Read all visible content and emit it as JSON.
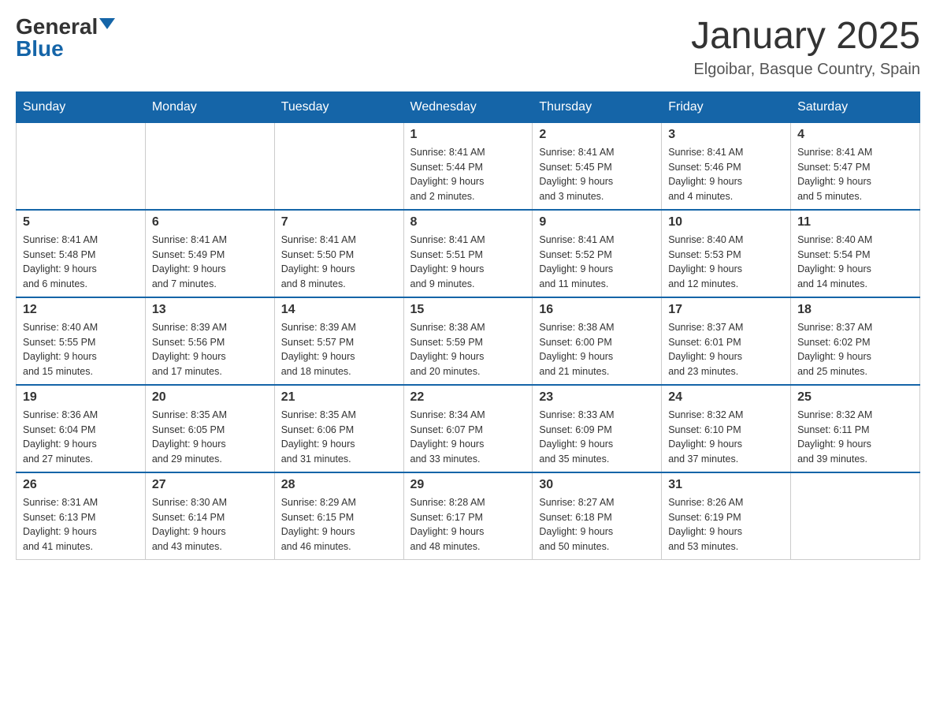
{
  "header": {
    "logo_general": "General",
    "logo_blue": "Blue",
    "title": "January 2025",
    "subtitle": "Elgoibar, Basque Country, Spain"
  },
  "days_of_week": [
    "Sunday",
    "Monday",
    "Tuesday",
    "Wednesday",
    "Thursday",
    "Friday",
    "Saturday"
  ],
  "weeks": [
    [
      {
        "day": "",
        "info": ""
      },
      {
        "day": "",
        "info": ""
      },
      {
        "day": "",
        "info": ""
      },
      {
        "day": "1",
        "info": "Sunrise: 8:41 AM\nSunset: 5:44 PM\nDaylight: 9 hours\nand 2 minutes."
      },
      {
        "day": "2",
        "info": "Sunrise: 8:41 AM\nSunset: 5:45 PM\nDaylight: 9 hours\nand 3 minutes."
      },
      {
        "day": "3",
        "info": "Sunrise: 8:41 AM\nSunset: 5:46 PM\nDaylight: 9 hours\nand 4 minutes."
      },
      {
        "day": "4",
        "info": "Sunrise: 8:41 AM\nSunset: 5:47 PM\nDaylight: 9 hours\nand 5 minutes."
      }
    ],
    [
      {
        "day": "5",
        "info": "Sunrise: 8:41 AM\nSunset: 5:48 PM\nDaylight: 9 hours\nand 6 minutes."
      },
      {
        "day": "6",
        "info": "Sunrise: 8:41 AM\nSunset: 5:49 PM\nDaylight: 9 hours\nand 7 minutes."
      },
      {
        "day": "7",
        "info": "Sunrise: 8:41 AM\nSunset: 5:50 PM\nDaylight: 9 hours\nand 8 minutes."
      },
      {
        "day": "8",
        "info": "Sunrise: 8:41 AM\nSunset: 5:51 PM\nDaylight: 9 hours\nand 9 minutes."
      },
      {
        "day": "9",
        "info": "Sunrise: 8:41 AM\nSunset: 5:52 PM\nDaylight: 9 hours\nand 11 minutes."
      },
      {
        "day": "10",
        "info": "Sunrise: 8:40 AM\nSunset: 5:53 PM\nDaylight: 9 hours\nand 12 minutes."
      },
      {
        "day": "11",
        "info": "Sunrise: 8:40 AM\nSunset: 5:54 PM\nDaylight: 9 hours\nand 14 minutes."
      }
    ],
    [
      {
        "day": "12",
        "info": "Sunrise: 8:40 AM\nSunset: 5:55 PM\nDaylight: 9 hours\nand 15 minutes."
      },
      {
        "day": "13",
        "info": "Sunrise: 8:39 AM\nSunset: 5:56 PM\nDaylight: 9 hours\nand 17 minutes."
      },
      {
        "day": "14",
        "info": "Sunrise: 8:39 AM\nSunset: 5:57 PM\nDaylight: 9 hours\nand 18 minutes."
      },
      {
        "day": "15",
        "info": "Sunrise: 8:38 AM\nSunset: 5:59 PM\nDaylight: 9 hours\nand 20 minutes."
      },
      {
        "day": "16",
        "info": "Sunrise: 8:38 AM\nSunset: 6:00 PM\nDaylight: 9 hours\nand 21 minutes."
      },
      {
        "day": "17",
        "info": "Sunrise: 8:37 AM\nSunset: 6:01 PM\nDaylight: 9 hours\nand 23 minutes."
      },
      {
        "day": "18",
        "info": "Sunrise: 8:37 AM\nSunset: 6:02 PM\nDaylight: 9 hours\nand 25 minutes."
      }
    ],
    [
      {
        "day": "19",
        "info": "Sunrise: 8:36 AM\nSunset: 6:04 PM\nDaylight: 9 hours\nand 27 minutes."
      },
      {
        "day": "20",
        "info": "Sunrise: 8:35 AM\nSunset: 6:05 PM\nDaylight: 9 hours\nand 29 minutes."
      },
      {
        "day": "21",
        "info": "Sunrise: 8:35 AM\nSunset: 6:06 PM\nDaylight: 9 hours\nand 31 minutes."
      },
      {
        "day": "22",
        "info": "Sunrise: 8:34 AM\nSunset: 6:07 PM\nDaylight: 9 hours\nand 33 minutes."
      },
      {
        "day": "23",
        "info": "Sunrise: 8:33 AM\nSunset: 6:09 PM\nDaylight: 9 hours\nand 35 minutes."
      },
      {
        "day": "24",
        "info": "Sunrise: 8:32 AM\nSunset: 6:10 PM\nDaylight: 9 hours\nand 37 minutes."
      },
      {
        "day": "25",
        "info": "Sunrise: 8:32 AM\nSunset: 6:11 PM\nDaylight: 9 hours\nand 39 minutes."
      }
    ],
    [
      {
        "day": "26",
        "info": "Sunrise: 8:31 AM\nSunset: 6:13 PM\nDaylight: 9 hours\nand 41 minutes."
      },
      {
        "day": "27",
        "info": "Sunrise: 8:30 AM\nSunset: 6:14 PM\nDaylight: 9 hours\nand 43 minutes."
      },
      {
        "day": "28",
        "info": "Sunrise: 8:29 AM\nSunset: 6:15 PM\nDaylight: 9 hours\nand 46 minutes."
      },
      {
        "day": "29",
        "info": "Sunrise: 8:28 AM\nSunset: 6:17 PM\nDaylight: 9 hours\nand 48 minutes."
      },
      {
        "day": "30",
        "info": "Sunrise: 8:27 AM\nSunset: 6:18 PM\nDaylight: 9 hours\nand 50 minutes."
      },
      {
        "day": "31",
        "info": "Sunrise: 8:26 AM\nSunset: 6:19 PM\nDaylight: 9 hours\nand 53 minutes."
      },
      {
        "day": "",
        "info": ""
      }
    ]
  ]
}
